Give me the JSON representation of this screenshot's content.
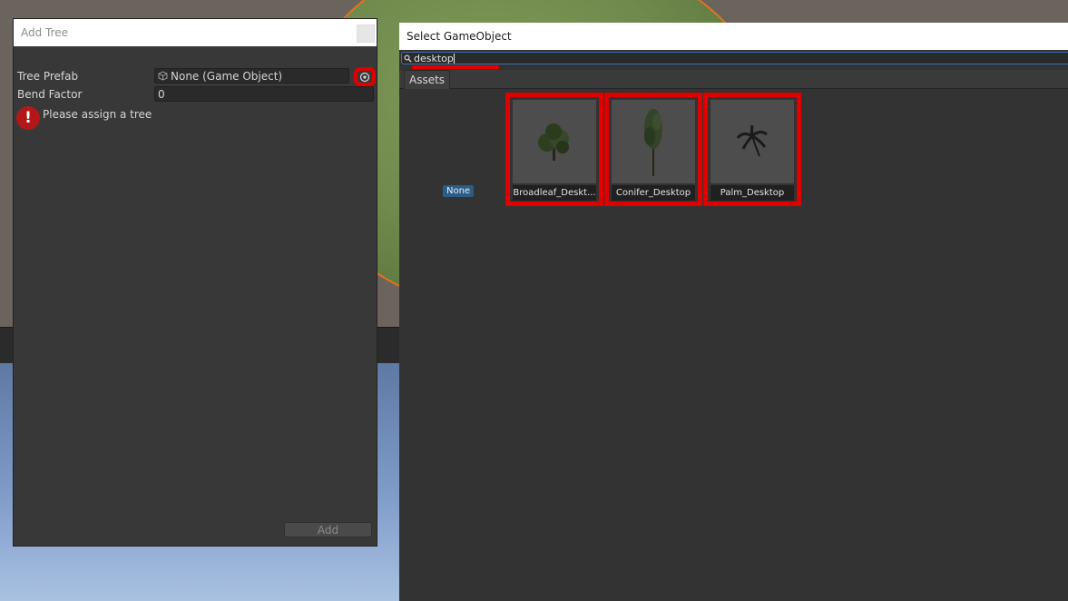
{
  "add_tree_window": {
    "title": "Add Tree",
    "tree_prefab_label": "Tree Prefab",
    "tree_prefab_value": "None (Game Object)",
    "bend_factor_label": "Bend Factor",
    "bend_factor_value": "0",
    "error_icon": "!",
    "error_message": "Please assign a tree",
    "add_button_label": "Add"
  },
  "select_gameobject_window": {
    "title": "Select GameObject",
    "search_value": "desktop",
    "tab_label": "Assets",
    "none_label": "None",
    "assets": [
      {
        "label": "Broadleaf_Deskt...",
        "icon": "broadleaf-tree-icon"
      },
      {
        "label": "Conifer_Desktop",
        "icon": "conifer-tree-icon"
      },
      {
        "label": "Palm_Desktop",
        "icon": "palm-tree-icon"
      }
    ]
  },
  "colors": {
    "highlight_red": "#e00000",
    "window_dark": "#383838",
    "accent_blue": "#3d6fa8"
  }
}
